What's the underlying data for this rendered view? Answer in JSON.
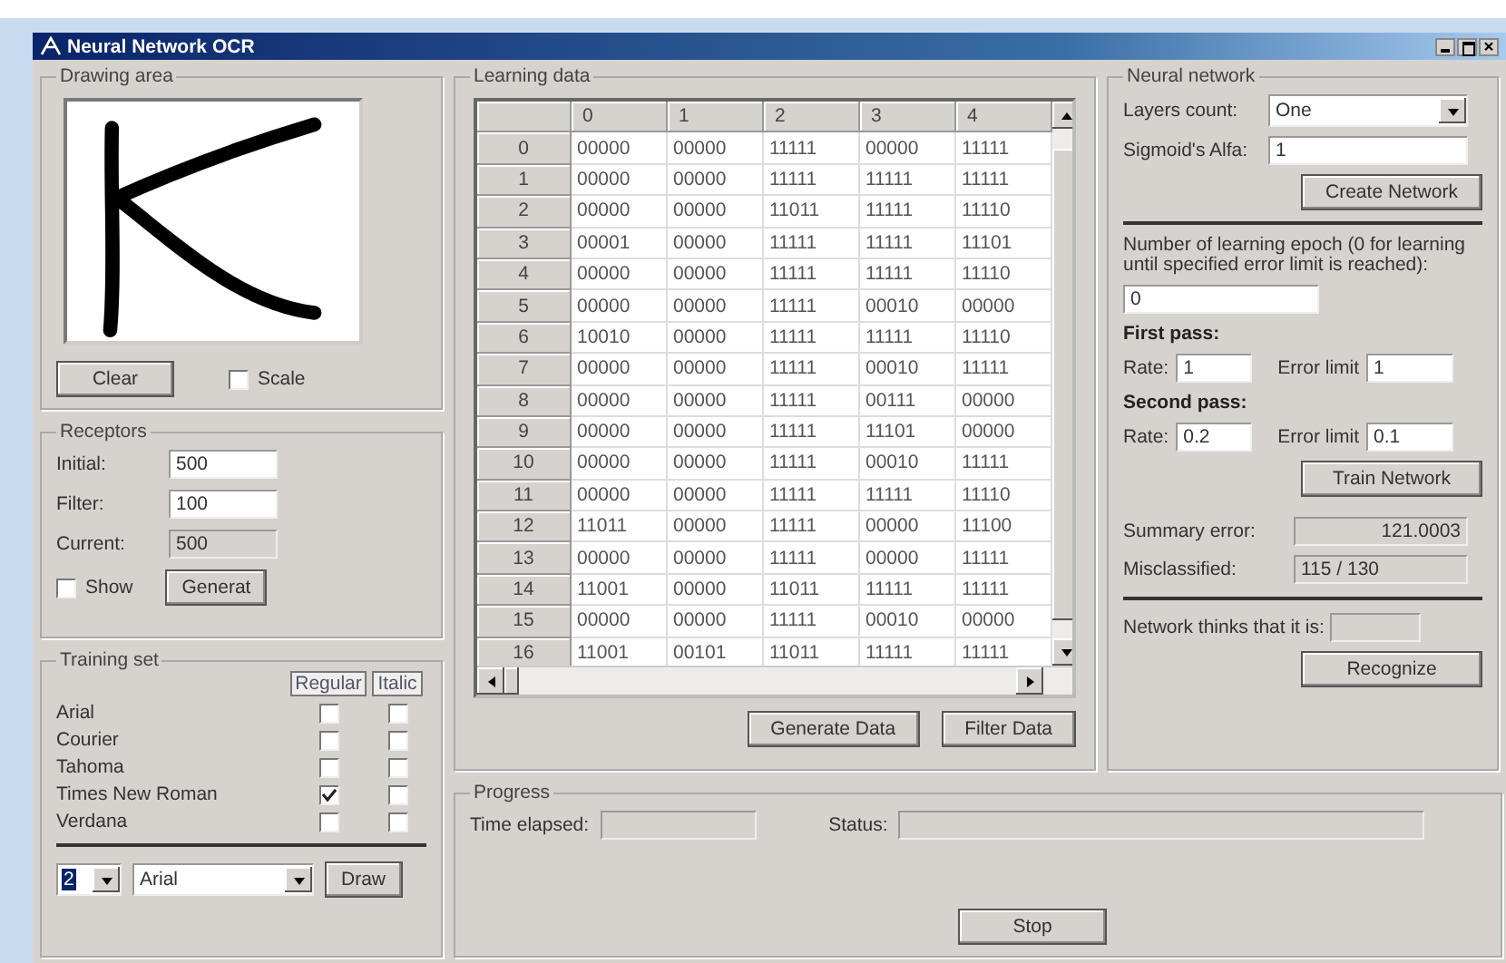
{
  "window": {
    "title": "Neural Network OCR"
  },
  "drawing_area": {
    "title": "Drawing area",
    "clear_button": "Clear",
    "scale": {
      "label": "Scale",
      "checked": false
    }
  },
  "receptors": {
    "title": "Receptors",
    "fields": [
      {
        "label": "Initial:",
        "value": "500",
        "disabled": false
      },
      {
        "label": "Filter:",
        "value": "100",
        "disabled": false
      },
      {
        "label": "Current:",
        "value": "500",
        "disabled": true
      }
    ],
    "show": {
      "label": "Show",
      "checked": false
    },
    "generate_button": "Generat"
  },
  "training_set": {
    "title": "Training set",
    "columns": [
      "Regular",
      "Italic"
    ],
    "fonts": [
      {
        "name": "Arial",
        "regular": false,
        "italic": false
      },
      {
        "name": "Courier",
        "regular": false,
        "italic": false
      },
      {
        "name": "Tahoma",
        "regular": false,
        "italic": false
      },
      {
        "name": "Times New Roman",
        "regular": true,
        "italic": false
      },
      {
        "name": "Verdana",
        "regular": false,
        "italic": false
      }
    ],
    "size_select": "2",
    "font_select": "Arial",
    "draw_button": "Draw"
  },
  "learning_data": {
    "title": "Learning data",
    "columns": [
      "0",
      "1",
      "2",
      "3",
      "4"
    ],
    "rows": [
      {
        "header": "0",
        "cells": [
          "00000",
          "00000",
          "11111",
          "00000",
          "11111"
        ]
      },
      {
        "header": "1",
        "cells": [
          "00000",
          "00000",
          "11111",
          "11111",
          "11111"
        ]
      },
      {
        "header": "2",
        "cells": [
          "00000",
          "00000",
          "11011",
          "11111",
          "11110"
        ]
      },
      {
        "header": "3",
        "cells": [
          "00001",
          "00000",
          "11111",
          "11111",
          "11101"
        ]
      },
      {
        "header": "4",
        "cells": [
          "00000",
          "00000",
          "11111",
          "11111",
          "11110"
        ]
      },
      {
        "header": "5",
        "cells": [
          "00000",
          "00000",
          "11111",
          "00010",
          "00000"
        ]
      },
      {
        "header": "6",
        "cells": [
          "10010",
          "00000",
          "11111",
          "11111",
          "11110"
        ]
      },
      {
        "header": "7",
        "cells": [
          "00000",
          "00000",
          "11111",
          "00010",
          "11111"
        ]
      },
      {
        "header": "8",
        "cells": [
          "00000",
          "00000",
          "11111",
          "00111",
          "00000"
        ]
      },
      {
        "header": "9",
        "cells": [
          "00000",
          "00000",
          "11111",
          "11101",
          "00000"
        ]
      },
      {
        "header": "10",
        "cells": [
          "00000",
          "00000",
          "11111",
          "00010",
          "11111"
        ]
      },
      {
        "header": "11",
        "cells": [
          "00000",
          "00000",
          "11111",
          "11111",
          "11110"
        ]
      },
      {
        "header": "12",
        "cells": [
          "11011",
          "00000",
          "11111",
          "00000",
          "11100"
        ]
      },
      {
        "header": "13",
        "cells": [
          "00000",
          "00000",
          "11111",
          "00000",
          "11111"
        ]
      },
      {
        "header": "14",
        "cells": [
          "11001",
          "00000",
          "11011",
          "11111",
          "11111"
        ]
      },
      {
        "header": "15",
        "cells": [
          "00000",
          "00000",
          "11111",
          "00010",
          "00000"
        ]
      },
      {
        "header": "16",
        "cells": [
          "11001",
          "00101",
          "11011",
          "11111",
          "11111"
        ]
      }
    ],
    "buttons": [
      "Generate Data",
      "Filter Data"
    ]
  },
  "progress": {
    "title": "Progress",
    "time_elapsed": {
      "label": "Time elapsed:",
      "disabled": true
    },
    "status": {
      "label": "Status:",
      "disabled": true
    },
    "stop_button": "Stop"
  },
  "neural_network": {
    "title": "Neural network",
    "layers_label": "Layers count:",
    "layers_value": "One",
    "alfa_label": "Sigmoid's Alfa:",
    "alfa_value": "1",
    "create_button": "Create Network",
    "epoch_text": "Number of learning epoch (0 for learning until specified error limit is reached):",
    "epoch_value": "0",
    "passes": [
      {
        "title": "First pass:",
        "rate_label": "Rate:",
        "rate": "1",
        "error_label": "Error limit",
        "error": "1"
      },
      {
        "title": "Second pass:",
        "rate_label": "Rate:",
        "rate": "0.2",
        "error_label": "Error limit",
        "error": "0.1"
      }
    ],
    "train_button": "Train Network",
    "summary": {
      "label": "Summary error:",
      "value": "121.0003",
      "disabled": true
    },
    "misclassified": {
      "label": "Misclassified:",
      "value": "115 / 130",
      "disabled": true
    },
    "thinks": {
      "label": "Network thinks that it is:",
      "disabled": true
    },
    "recognize_button": "Recognize"
  }
}
